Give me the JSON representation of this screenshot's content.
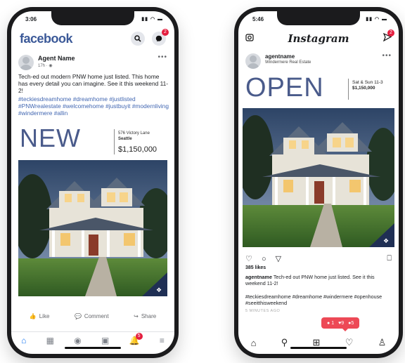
{
  "facebook": {
    "status_time": "3:06",
    "logo": "facebook",
    "icons": {
      "search": "search-icon",
      "messenger": "messenger-icon"
    },
    "messenger_badge": "2",
    "post": {
      "author": "Agent Name",
      "time": "17h · ",
      "text": "Tech-ed out modern PNW home just listed. This home has every detail you can imagine. See it this weekend 11-2!",
      "hashtags": "#teckiesdreamhome #dreamhome #justlisted #PNWrealestate #welcomehome #justbuyit #modernliving #windermere #allin",
      "ad": {
        "headline": "NEW",
        "address_line1": "576 Victory Lane",
        "address_line2": "Seattle",
        "price": "$1,150,000"
      },
      "actions": {
        "like": "Like",
        "comment": "Comment",
        "share": "Share"
      }
    },
    "nav_badge": "5",
    "nav_items": [
      "home-icon",
      "marketplace-icon",
      "groups-icon",
      "pages-icon",
      "notifications-icon",
      "menu-icon"
    ]
  },
  "instagram": {
    "status_time": "5:46",
    "logo": "Instagram",
    "direct_badge": "2",
    "post": {
      "username": "agentname",
      "subtitle": "Windermere Real Estate",
      "ad": {
        "headline": "OPEN",
        "date_line": "Sat & Sun 11-3",
        "price": "$1,150,000"
      },
      "likes": "385 likes",
      "caption_user": "agentname",
      "caption_text": " Tech-ed out PNW home just listed. See it this weekend 11-2!",
      "hashtags": "#teckiesdreamhome #dreamhome #windermere #openhouse #seeitthisweekend",
      "timestamp": "5 MINUTES AGO"
    },
    "notification": {
      "comments": "1",
      "likes": "9",
      "follows": "5"
    },
    "nav_items": [
      "home-icon",
      "search-icon",
      "add-post-icon",
      "activity-icon",
      "profile-icon"
    ]
  },
  "colors": {
    "facebook_blue": "#3b5998",
    "instagram_red": "#ed4956",
    "ad_text": "#4a5b8b"
  }
}
